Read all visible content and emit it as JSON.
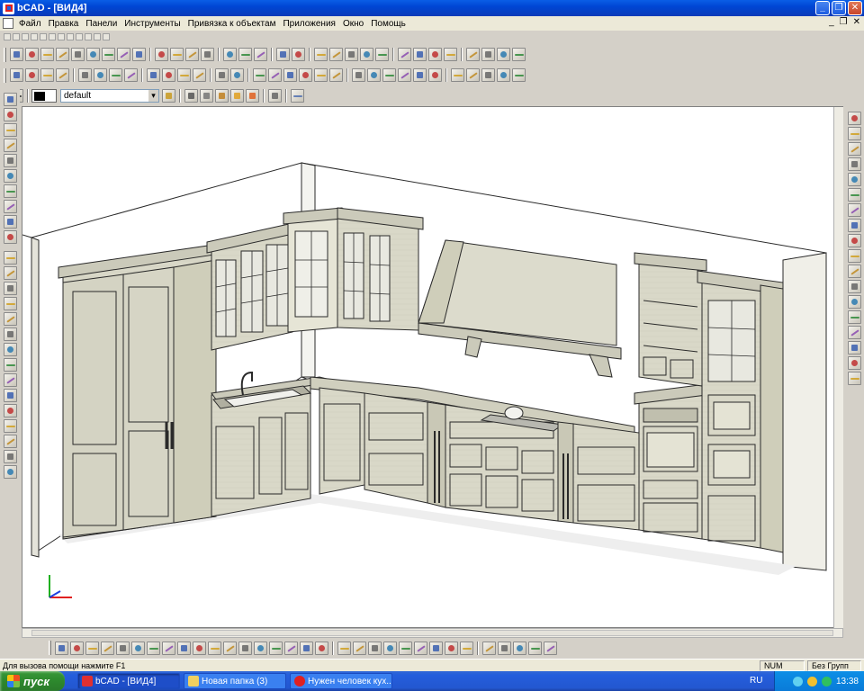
{
  "window": {
    "title": "bCAD - [ВИД4]"
  },
  "menu": [
    "Файл",
    "Правка",
    "Панели",
    "Инструменты",
    "Привязка к объектам",
    "Приложения",
    "Окно",
    "Помощь"
  ],
  "layer_select": {
    "value": "default"
  },
  "statusbar": {
    "message": "Для вызова помощи нажмите F1",
    "num": "NUM",
    "group": "Без Групп"
  },
  "taskbar": {
    "start_label": "пуск",
    "tasks": [
      {
        "label": "bCAD - [ВИД4]"
      },
      {
        "label": "Новая папка (3)"
      },
      {
        "label": "Нужен человек кух..."
      }
    ],
    "lang": "RU",
    "clock": "13:38"
  },
  "colors": {
    "title_bar": "#0a5ee6",
    "cabinet_fill": "#d9d8c8",
    "cabinet_stroke": "#2a2a2a",
    "wall_fill": "#ffffff"
  },
  "icons": {
    "toolbar1": [
      "new-file-icon",
      "new-icon",
      "open-icon",
      "save-icon",
      "print-icon",
      "print-preview-icon",
      "folder-icon",
      "save-as-icon",
      "export-icon",
      "select-icon",
      "select-plus-icon",
      "move-icon",
      "erase-icon",
      "copy-icon",
      "paste-icon",
      "cut-icon",
      "undo-icon",
      "redo-icon",
      "arc-icon",
      "line-icon",
      "polyline-icon",
      "curve-icon",
      "spline-icon",
      "zoom-icon",
      "zoom-window-icon",
      "pan-icon",
      "light-icon",
      "render-icon",
      "stop-icon",
      "hammer-icon",
      "paint-icon"
    ],
    "toolbar2": [
      "snap-icon",
      "cursor-icon",
      "cross-icon",
      "point-icon",
      "box-icon",
      "cube-icon",
      "sphere-icon",
      "cylinder-icon",
      "dimension-icon",
      "angle-icon",
      "circle-icon",
      "target-icon",
      "plus-icon",
      "pipe-icon",
      "join-icon",
      "cut-icon",
      "rotate-icon",
      "mirror-icon",
      "array-icon",
      "scale-icon",
      "trim-icon",
      "extend-icon",
      "fillet-icon",
      "chamfer-icon",
      "explode-icon",
      "group-icon",
      "material-icon",
      "texture-icon",
      "lamp-icon",
      "camera-icon",
      "pen-icon"
    ],
    "left": [
      "line-tool-icon",
      "circle-tool-icon",
      "arc-tool-icon",
      "spline-tool-icon",
      "rectangle-tool-icon",
      "text-tool-icon",
      "hatch-tool-icon",
      "block-tool-icon",
      "polygon-tool-icon",
      "ellipse-tool-icon",
      "point-tool-icon",
      "measure-tool-icon",
      "slash-tool-icon"
    ],
    "right": [
      "zoom-in-icon",
      "zoom-out-icon",
      "view-eye-icon",
      "view-front-icon",
      "view-top-icon",
      "view-right-icon",
      "view-iso-icon",
      "pencil-icon",
      "light-bulb-icon",
      "layers-icon",
      "grid-icon",
      "ruler-icon",
      "image-icon",
      "brush-icon",
      "fill-icon",
      "cube-view-icon",
      "box-view-icon",
      "zoom-all-icon"
    ]
  }
}
